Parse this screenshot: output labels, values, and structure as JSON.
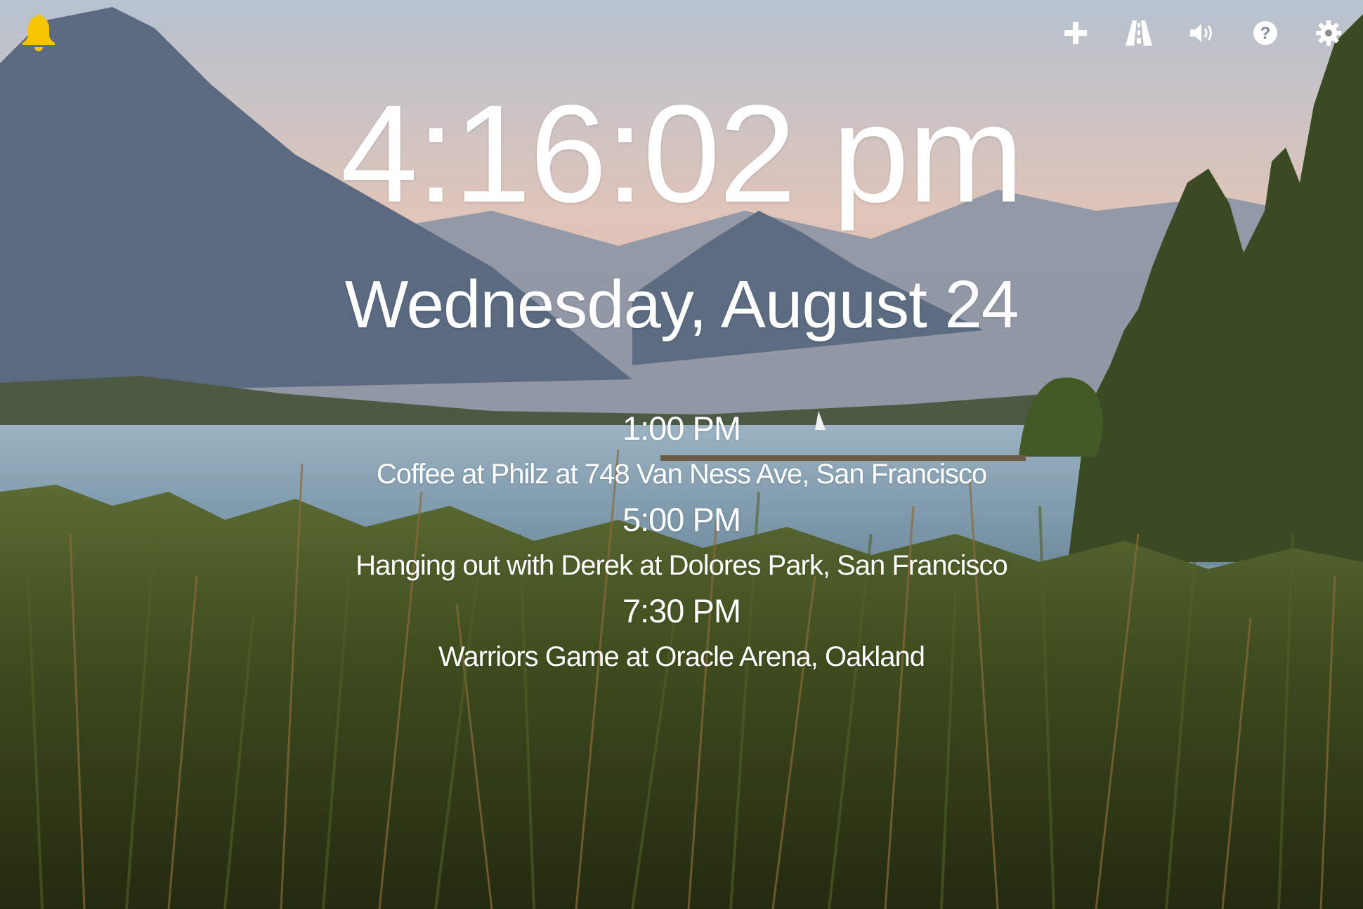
{
  "clock": {
    "time": "4:16:02 pm",
    "date": "Wednesday, August 24"
  },
  "events": [
    {
      "time": "1:00 PM",
      "title": "Coffee at Philz at 748 Van Ness Ave, San Francisco"
    },
    {
      "time": "5:00 PM",
      "title": "Hanging out with Derek at Dolores Park, San Francisco"
    },
    {
      "time": "7:30 PM",
      "title": "Warriors Game at Oracle Arena, Oakland"
    }
  ],
  "toolbar": {
    "icons": [
      "bell-icon",
      "plus-icon",
      "road-icon",
      "volume-icon",
      "help-icon",
      "gear-icon"
    ]
  },
  "colors": {
    "bell": "#f5c400",
    "text": "#ffffff"
  }
}
